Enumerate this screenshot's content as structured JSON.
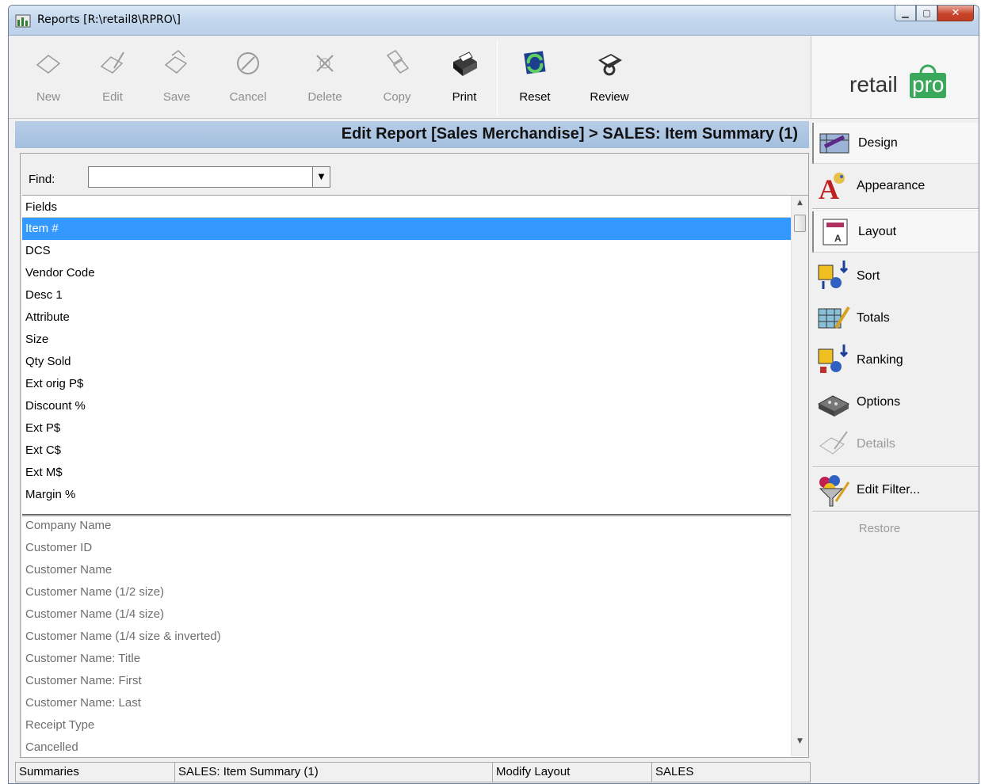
{
  "window": {
    "title": "Reports [R:\\retail8\\RPRO\\]",
    "controls": [
      "minimize",
      "maximize",
      "close"
    ]
  },
  "toolbar": {
    "new_label": "New",
    "edit_label": "Edit",
    "save_label": "Save",
    "cancel_label": "Cancel",
    "delete_label": "Delete",
    "copy_label": "Copy",
    "print_label": "Print",
    "reset_label": "Reset",
    "review_label": "Review"
  },
  "logo": {
    "text_left": "retail",
    "text_right": "pro"
  },
  "header": {
    "title": "Edit Report [Sales Merchandise] > SALES: Item Summary (1)"
  },
  "find": {
    "label": "Find:",
    "value": ""
  },
  "fields": {
    "header": "Fields",
    "selected": [
      "Item #",
      "DCS",
      "Vendor Code",
      "Desc 1",
      "Attribute",
      "Size",
      "Qty Sold",
      "Ext orig P$",
      "Discount %",
      "Ext P$",
      "Ext C$",
      "Ext M$",
      "Margin %"
    ],
    "available": [
      "Company Name",
      "Customer ID",
      "Customer Name",
      "Customer Name (1/2 size)",
      "Customer Name (1/4 size)",
      "Customer Name (1/4 size & inverted)",
      "Customer Name: Title",
      "Customer Name: First",
      "Customer Name: Last",
      "Receipt Type",
      "Cancelled"
    ]
  },
  "nav": {
    "design": "Design",
    "appearance": "Appearance",
    "layout": "Layout",
    "sort": "Sort",
    "totals": "Totals",
    "ranking": "Ranking",
    "options": "Options",
    "details": "Details",
    "edit_filter": "Edit Filter...",
    "restore": "Restore"
  },
  "status": {
    "cell1": "Summaries",
    "cell2": "SALES: Item Summary (1)",
    "cell3": "Modify Layout",
    "cell4": "SALES"
  },
  "colors": {
    "selection": "#3399ff",
    "header_band": "#a9c3e2",
    "logo_green": "#3aa85a"
  }
}
